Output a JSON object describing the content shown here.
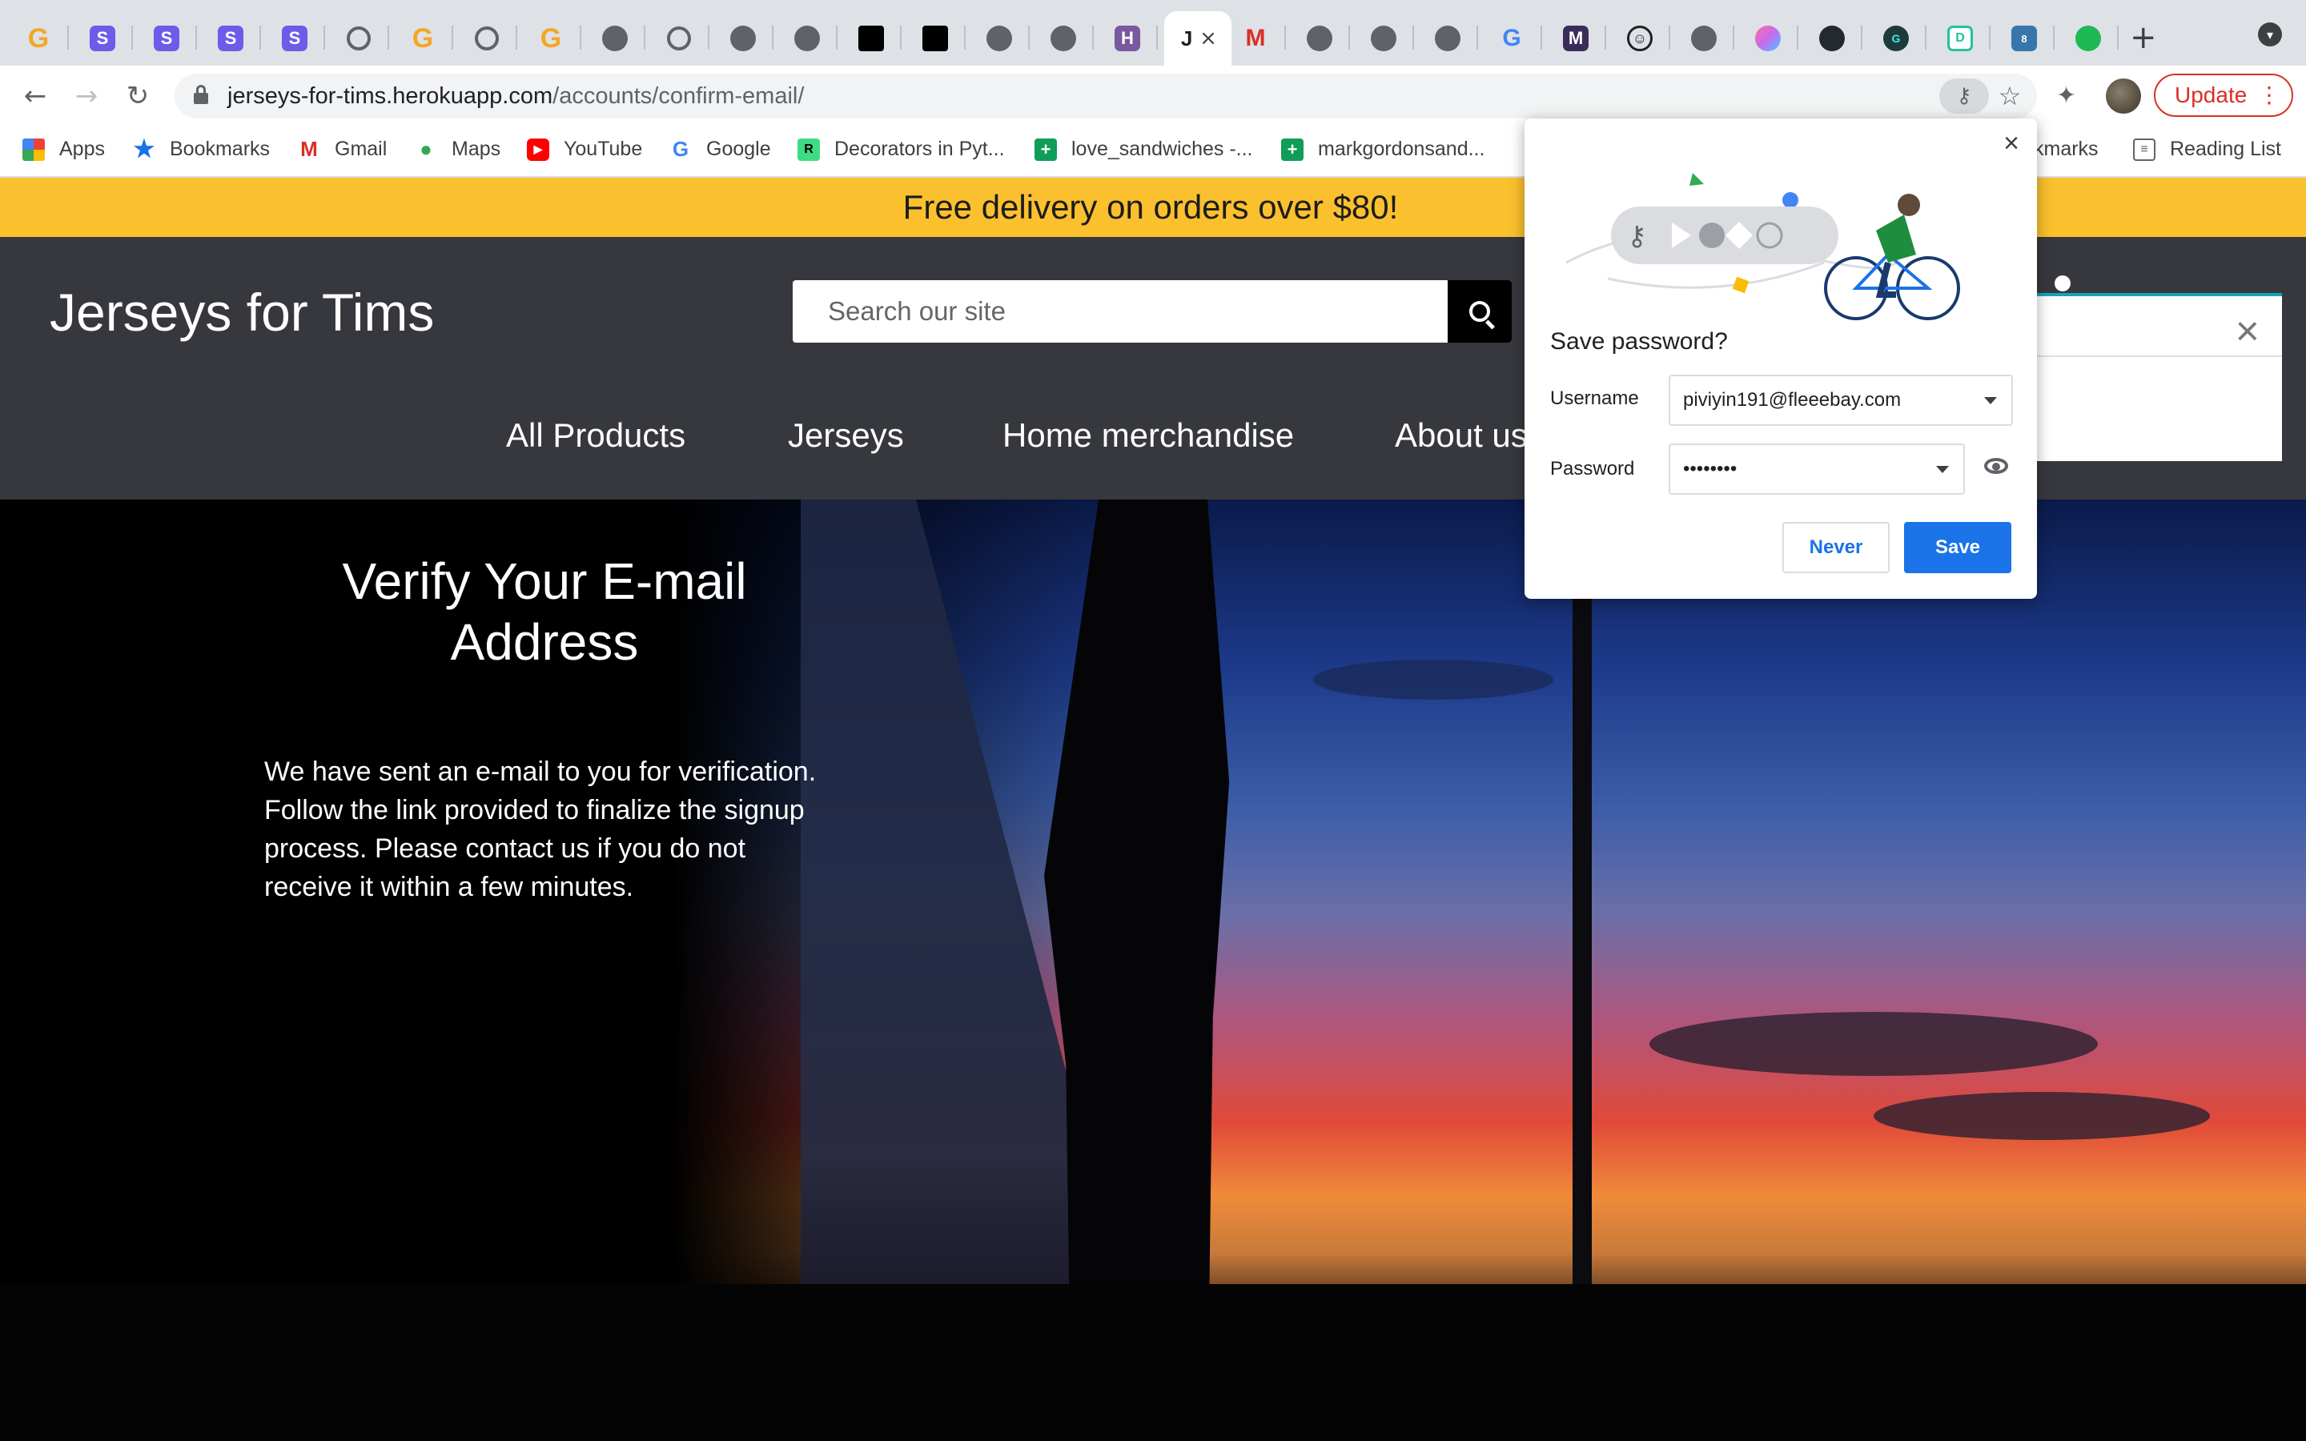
{
  "browser": {
    "active_tab_letter": "J",
    "url_domain": "jerseys-for-tims.herokuapp.com",
    "url_path": "/accounts/confirm-email/",
    "update_label": "Update",
    "bookmarks": [
      {
        "label": "Apps",
        "icon": "apps-grid-icon"
      },
      {
        "label": "Bookmarks",
        "icon": "star-icon"
      },
      {
        "label": "Gmail",
        "icon": "gmail-icon"
      },
      {
        "label": "Maps",
        "icon": "maps-pin-icon"
      },
      {
        "label": "YouTube",
        "icon": "youtube-icon"
      },
      {
        "label": "Google",
        "icon": "google-icon"
      },
      {
        "label": "Decorators in Pyt...",
        "icon": "site-icon"
      },
      {
        "label": "love_sandwiches -...",
        "icon": "sheets-icon"
      },
      {
        "label": "markgordonsand...",
        "icon": "sheets-icon"
      },
      {
        "label": "kmarks",
        "icon": "folder-icon"
      },
      {
        "label": "Reading List",
        "icon": "reading-list-icon"
      }
    ]
  },
  "site": {
    "banner": "Free delivery on orders over $80!",
    "brand": "Jerseys for Tims",
    "search_placeholder": "Search our site",
    "nav": [
      "All Products",
      "Jerseys",
      "Home merchandise",
      "About us"
    ],
    "verify_title": "Verify Your E-mail Address",
    "verify_body": "We have sent an e-mail to you for verification. Follow the link provided to finalize the signup process. Please contact us if you do not receive it within a few minutes."
  },
  "password_dialog": {
    "title": "Save password?",
    "username_label": "Username",
    "username_value": "piviyin191@fleeebay.com",
    "password_label": "Password",
    "password_value": "••••••••",
    "never_label": "Never",
    "save_label": "Save",
    "close_label": "×"
  },
  "toast": {
    "close_label": "×"
  },
  "colors": {
    "banner": "#fbc02d",
    "header": "#36383e",
    "save_button": "#1a73e8",
    "update": "#d93025"
  }
}
